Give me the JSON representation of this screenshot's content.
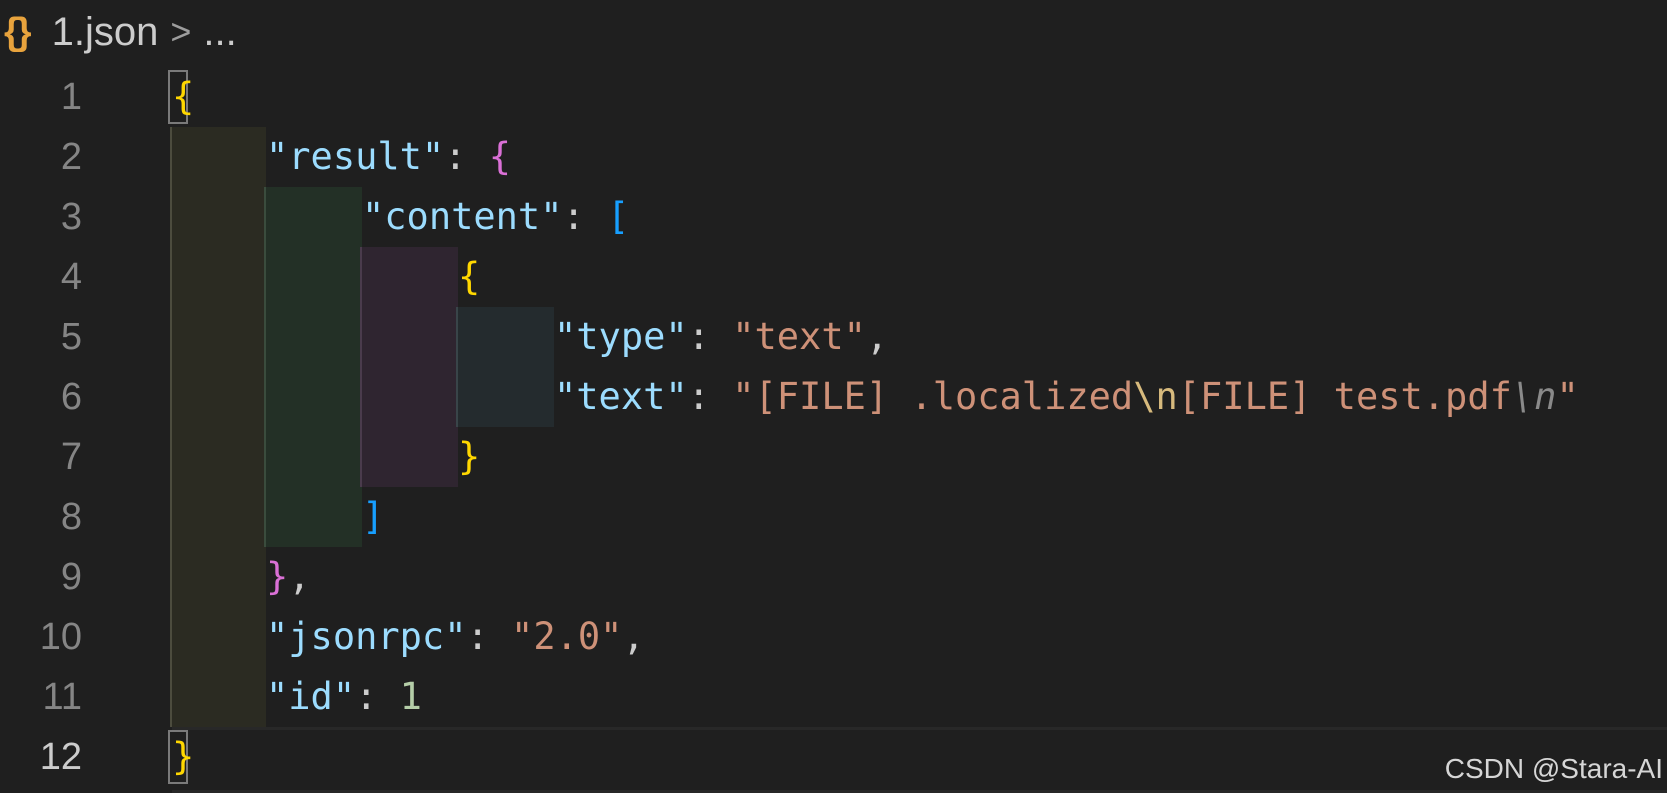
{
  "breadcrumb": {
    "file_icon": "json-braces-icon",
    "file_icon_glyph": "{}",
    "file_name": "1.json",
    "separator": ">",
    "more": "..."
  },
  "editor": {
    "line_numbers": [
      "1",
      "2",
      "3",
      "4",
      "5",
      "6",
      "7",
      "8",
      "9",
      "10",
      "11",
      "12"
    ],
    "active_line": 12,
    "tokens": {
      "l1_open": "{",
      "l2_key": "\"result\"",
      "l2_colon": ": ",
      "l2_open": "{",
      "l3_key": "\"content\"",
      "l3_colon": ": ",
      "l3_open": "[",
      "l4_open": "{",
      "l5_key": "\"type\"",
      "l5_colon": ": ",
      "l5_val": "\"text\"",
      "l5_comma": ",",
      "l6_key": "\"text\"",
      "l6_colon": ": ",
      "l6_val_a": "\"[FILE] .localized",
      "l6_esc1": "\\n",
      "l6_val_b": "[FILE] test.pdf",
      "l6_esc2": "\\n",
      "l6_val_c": "\"",
      "l7_close": "}",
      "l8_close": "]",
      "l9_close": "}",
      "l9_comma": ",",
      "l10_key": "\"jsonrpc\"",
      "l10_colon": ": ",
      "l10_val": "\"2.0\"",
      "l10_comma": ",",
      "l11_key": "\"id\"",
      "l11_colon": ": ",
      "l11_val": "1",
      "l12_close": "}"
    }
  },
  "watermark": "CSDN @Stara-AI",
  "colors": {
    "background": "#1f1f1f",
    "key": "#9cdcfe",
    "string": "#ce9178",
    "number": "#b5cea8",
    "bracket_level1": "#ffd700",
    "bracket_level2": "#da70d6",
    "bracket_level3": "#179fff"
  }
}
